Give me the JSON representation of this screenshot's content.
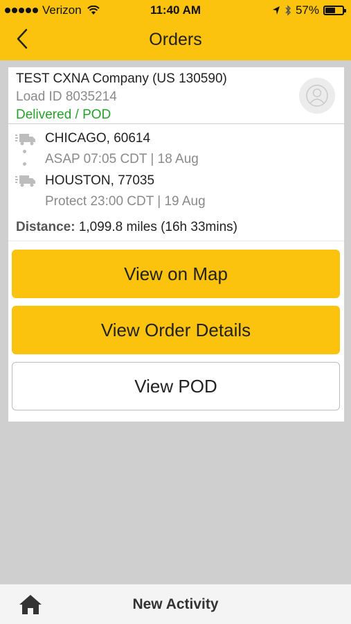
{
  "status_bar": {
    "carrier": "Verizon",
    "time": "11:40 AM",
    "battery": "57%",
    "battery_level": 0.57,
    "icons": [
      "signal-dots-icon",
      "wifi-icon",
      "location-arrow-icon",
      "bluetooth-icon",
      "battery-icon"
    ]
  },
  "nav": {
    "title": "Orders",
    "back_icon": "chevron-left-icon"
  },
  "order": {
    "company": "TEST CXNA Company (US 130590)",
    "load_id": "Load ID 8035214",
    "status": "Delivered / POD",
    "status_color": "#25a12c",
    "avatar_icon": "user-avatar-icon"
  },
  "route": {
    "origin_city": "CHICAGO, 60614",
    "origin_time": "ASAP 07:05 CDT | 18 Aug",
    "destination_city": "HOUSTON, 77035",
    "destination_time": "Protect 23:00 CDT | 19 Aug",
    "distance_label": "Distance:",
    "distance_value": "1,099.8 miles (16h 33mins)"
  },
  "actions": {
    "view_map": "View on Map",
    "view_details": "View Order Details",
    "view_pod": "View POD"
  },
  "tab_bar": {
    "home_icon": "home-icon",
    "new_activity": "New Activity"
  },
  "colors": {
    "brand_yellow": "#fbc20e",
    "background_gray": "#cfcfcf"
  }
}
